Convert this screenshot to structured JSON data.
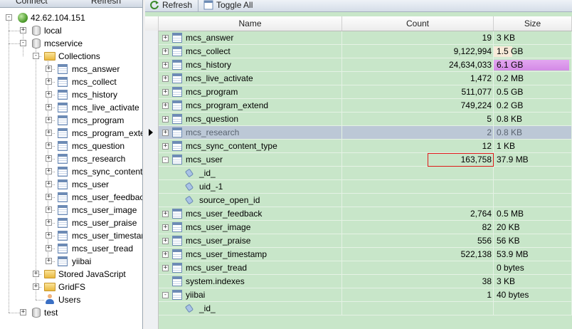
{
  "left_toolbar": {
    "connect_label": "Connect",
    "refresh_label": "Refresh"
  },
  "tree": {
    "server": "42.62.104.151",
    "databases": [
      {
        "name": "local"
      },
      {
        "name": "mcservice"
      },
      {
        "name": "test"
      }
    ],
    "collections_label": "Collections",
    "collections": [
      "mcs_answer",
      "mcs_collect",
      "mcs_history",
      "mcs_live_activate",
      "mcs_program",
      "mcs_program_exte",
      "mcs_question",
      "mcs_research",
      "mcs_sync_content",
      "mcs_user",
      "mcs_user_feedback",
      "mcs_user_image",
      "mcs_user_praise",
      "mcs_user_timestar",
      "mcs_user_tread",
      "yiibai"
    ],
    "stored_js_label": "Stored JavaScript",
    "gridfs_label": "GridFS",
    "users_label": "Users"
  },
  "toolbar": {
    "refresh_label": "Refresh",
    "toggle_all_label": "Toggle All"
  },
  "columns": {
    "name": "Name",
    "count": "Count",
    "size": "Size"
  },
  "rows": [
    {
      "name": "mcs_answer",
      "count": "19",
      "size": "3 KB",
      "kind": "collection",
      "bar": 0
    },
    {
      "name": "mcs_collect",
      "count": "9,122,994",
      "size": "1.5 GB",
      "kind": "collection",
      "bar": 0.246
    },
    {
      "name": "mcs_history",
      "count": "24,634,033",
      "size": "6.1 GB",
      "kind": "collection",
      "bar": 1.0
    },
    {
      "name": "mcs_live_activate",
      "count": "1,472",
      "size": "0.2 MB",
      "kind": "collection",
      "bar": 0
    },
    {
      "name": "mcs_program",
      "count": "511,077",
      "size": "0.5 GB",
      "kind": "collection",
      "bar": 0
    },
    {
      "name": "mcs_program_extend",
      "count": "749,224",
      "size": "0.2 GB",
      "kind": "collection",
      "bar": 0
    },
    {
      "name": "mcs_question",
      "count": "5",
      "size": "0.8 KB",
      "kind": "collection",
      "bar": 0
    },
    {
      "name": "mcs_research",
      "count": "2",
      "size": "0.8 KB",
      "kind": "collection",
      "bar": 0,
      "selected": true
    },
    {
      "name": "mcs_sync_content_type",
      "count": "12",
      "size": "1 KB",
      "kind": "collection",
      "bar": 0
    },
    {
      "name": "mcs_user",
      "count": "163,758",
      "size": "37.9 MB",
      "kind": "collection",
      "bar": 0,
      "expanded": true,
      "highlight_count": true
    },
    {
      "name": "_id_",
      "count": "",
      "size": "",
      "kind": "index"
    },
    {
      "name": "uid_-1",
      "count": "",
      "size": "",
      "kind": "index"
    },
    {
      "name": "source_open_id",
      "count": "",
      "size": "",
      "kind": "index"
    },
    {
      "name": "mcs_user_feedback",
      "count": "2,764",
      "size": "0.5 MB",
      "kind": "collection",
      "bar": 0
    },
    {
      "name": "mcs_user_image",
      "count": "82",
      "size": "20 KB",
      "kind": "collection",
      "bar": 0
    },
    {
      "name": "mcs_user_praise",
      "count": "556",
      "size": "56 KB",
      "kind": "collection",
      "bar": 0
    },
    {
      "name": "mcs_user_timestamp",
      "count": "522,138",
      "size": "53.9 MB",
      "kind": "collection",
      "bar": 0
    },
    {
      "name": "mcs_user_tread",
      "count": "",
      "size": "0 bytes",
      "kind": "collection",
      "bar": 0
    },
    {
      "name": "system.indexes",
      "count": "38",
      "size": "3 KB",
      "kind": "collection",
      "bar": 0,
      "no_expander": true
    },
    {
      "name": "yiibai",
      "count": "1",
      "size": "40 bytes",
      "kind": "collection",
      "bar": 0,
      "expanded": true
    },
    {
      "name": "_id_",
      "count": "",
      "size": "",
      "kind": "index"
    }
  ],
  "colors": {
    "row_bg": "#c8e6c9",
    "selected_bg": "#bcc8d6",
    "size_bar": "#e3a6f0",
    "highlight_border": "#e01a1a"
  }
}
